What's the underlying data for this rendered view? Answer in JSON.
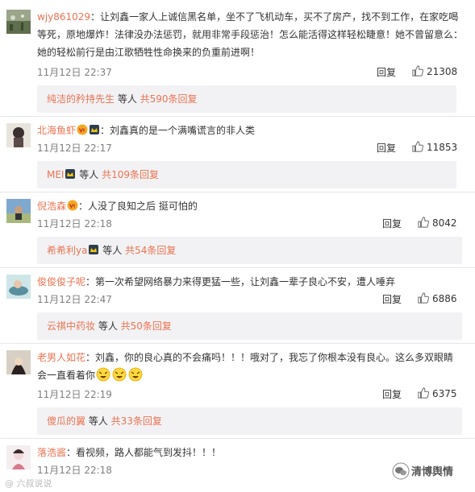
{
  "comments": [
    {
      "user": "wjy861029",
      "text": "：让刘鑫一家人上诚信黑名单，坐不了飞机动车，买不了房产，找不到工作，在家吃喝等死，原地爆炸！法律没办法惩罚，就用非常手段惩治！怎么能活得这样轻松睫意！她不曾留意么：她的轻松前行是由江歌牺牲性命换来的负重前进啊！",
      "time": "11月12日 22:37",
      "reply": "回复",
      "likes": "21308",
      "more_user": "纯洁的矜持先生",
      "more_mid": " 等人 ",
      "more_count": "共590条回复"
    },
    {
      "user": "北海鱼虾",
      "text": "：刘鑫真的是一个满嘴谎言的非人类",
      "time": "11月12日 22:17",
      "reply": "回复",
      "likes": "11853",
      "more_user": "MEI",
      "more_mid": "  等人 ",
      "more_count": "共109条回复"
    },
    {
      "user": "倪浩森",
      "text": "：人没了良知之后 挺可怕的",
      "time": "11月12日 22:18",
      "reply": "回复",
      "likes": "8042",
      "more_user": "希希利ya",
      "more_mid": " 等人 ",
      "more_count": "共54条回复"
    },
    {
      "user": "俊俊俊子呢",
      "text": "：第一次希望网络暴力来得更猛一些，让刘鑫一辈子良心不安，遭人唾弃",
      "time": "11月12日 22:47",
      "reply": "回复",
      "likes": "6886",
      "more_user": "云祺中药妆",
      "more_mid": " 等人 ",
      "more_count": "共50条回复"
    },
    {
      "user": "老男人如花",
      "text_a": "：刘鑫，你的良心真的不会痛吗！！！哦对了，我忘了你根本没有良心。这么多双眼睛会一直看着你",
      "time": "11月12日 22:19",
      "reply": "回复",
      "likes": "6375",
      "more_user": "傻瓜的翼",
      "more_mid": " 等人 ",
      "more_count": "共33条回复"
    },
    {
      "user": "落浩酱",
      "text": "：看视频，路人都能气到发抖！！！",
      "time": "11月12日 22:18"
    }
  ],
  "watermarks": {
    "left": "@ 六叔说说",
    "right": "清博舆情"
  },
  "colors": {
    "username": "#eb7350",
    "meta": "#808080",
    "more_bg": "#f2f2f5"
  }
}
